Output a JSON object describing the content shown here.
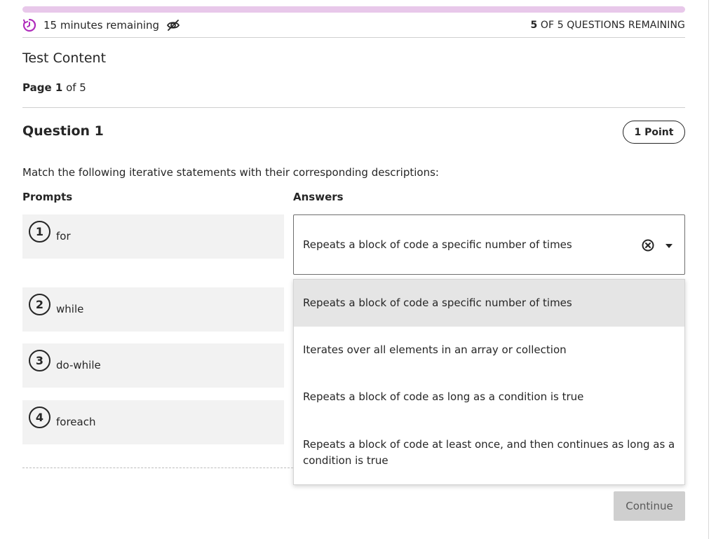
{
  "header": {
    "timer_text": "15 minutes remaining",
    "remaining_count": "5",
    "remaining_text": " OF 5 QUESTIONS REMAINING",
    "accent_color": "#b02ebc",
    "progress_color": "#e8c8ea"
  },
  "content": {
    "section_title": "Test Content",
    "page_bold": "Page 1",
    "page_rest": " of 5"
  },
  "question": {
    "title": "Question 1",
    "points": "1 Point",
    "instructions": "Match the following iterative statements with their corresponding descriptions:",
    "prompts_header": "Prompts",
    "answers_header": "Answers",
    "prompts": [
      {
        "number": "1",
        "label": "for"
      },
      {
        "number": "2",
        "label": "while"
      },
      {
        "number": "3",
        "label": "do-while"
      },
      {
        "number": "4",
        "label": "foreach"
      }
    ],
    "selected_answer": "Repeats a block of code a specific number of times",
    "options": [
      "Repeats a block of code a specific number of times",
      "Iterates over all elements in an array or collection",
      "Repeats a block of code as long as a condition is true",
      "Repeats a block of code at least once, and then continues as long as a condition is true"
    ]
  },
  "footer": {
    "continue_label": "Continue"
  },
  "icons": [
    "timer-icon",
    "eye-slash-icon",
    "clear-circle-icon",
    "caret-down-icon"
  ]
}
